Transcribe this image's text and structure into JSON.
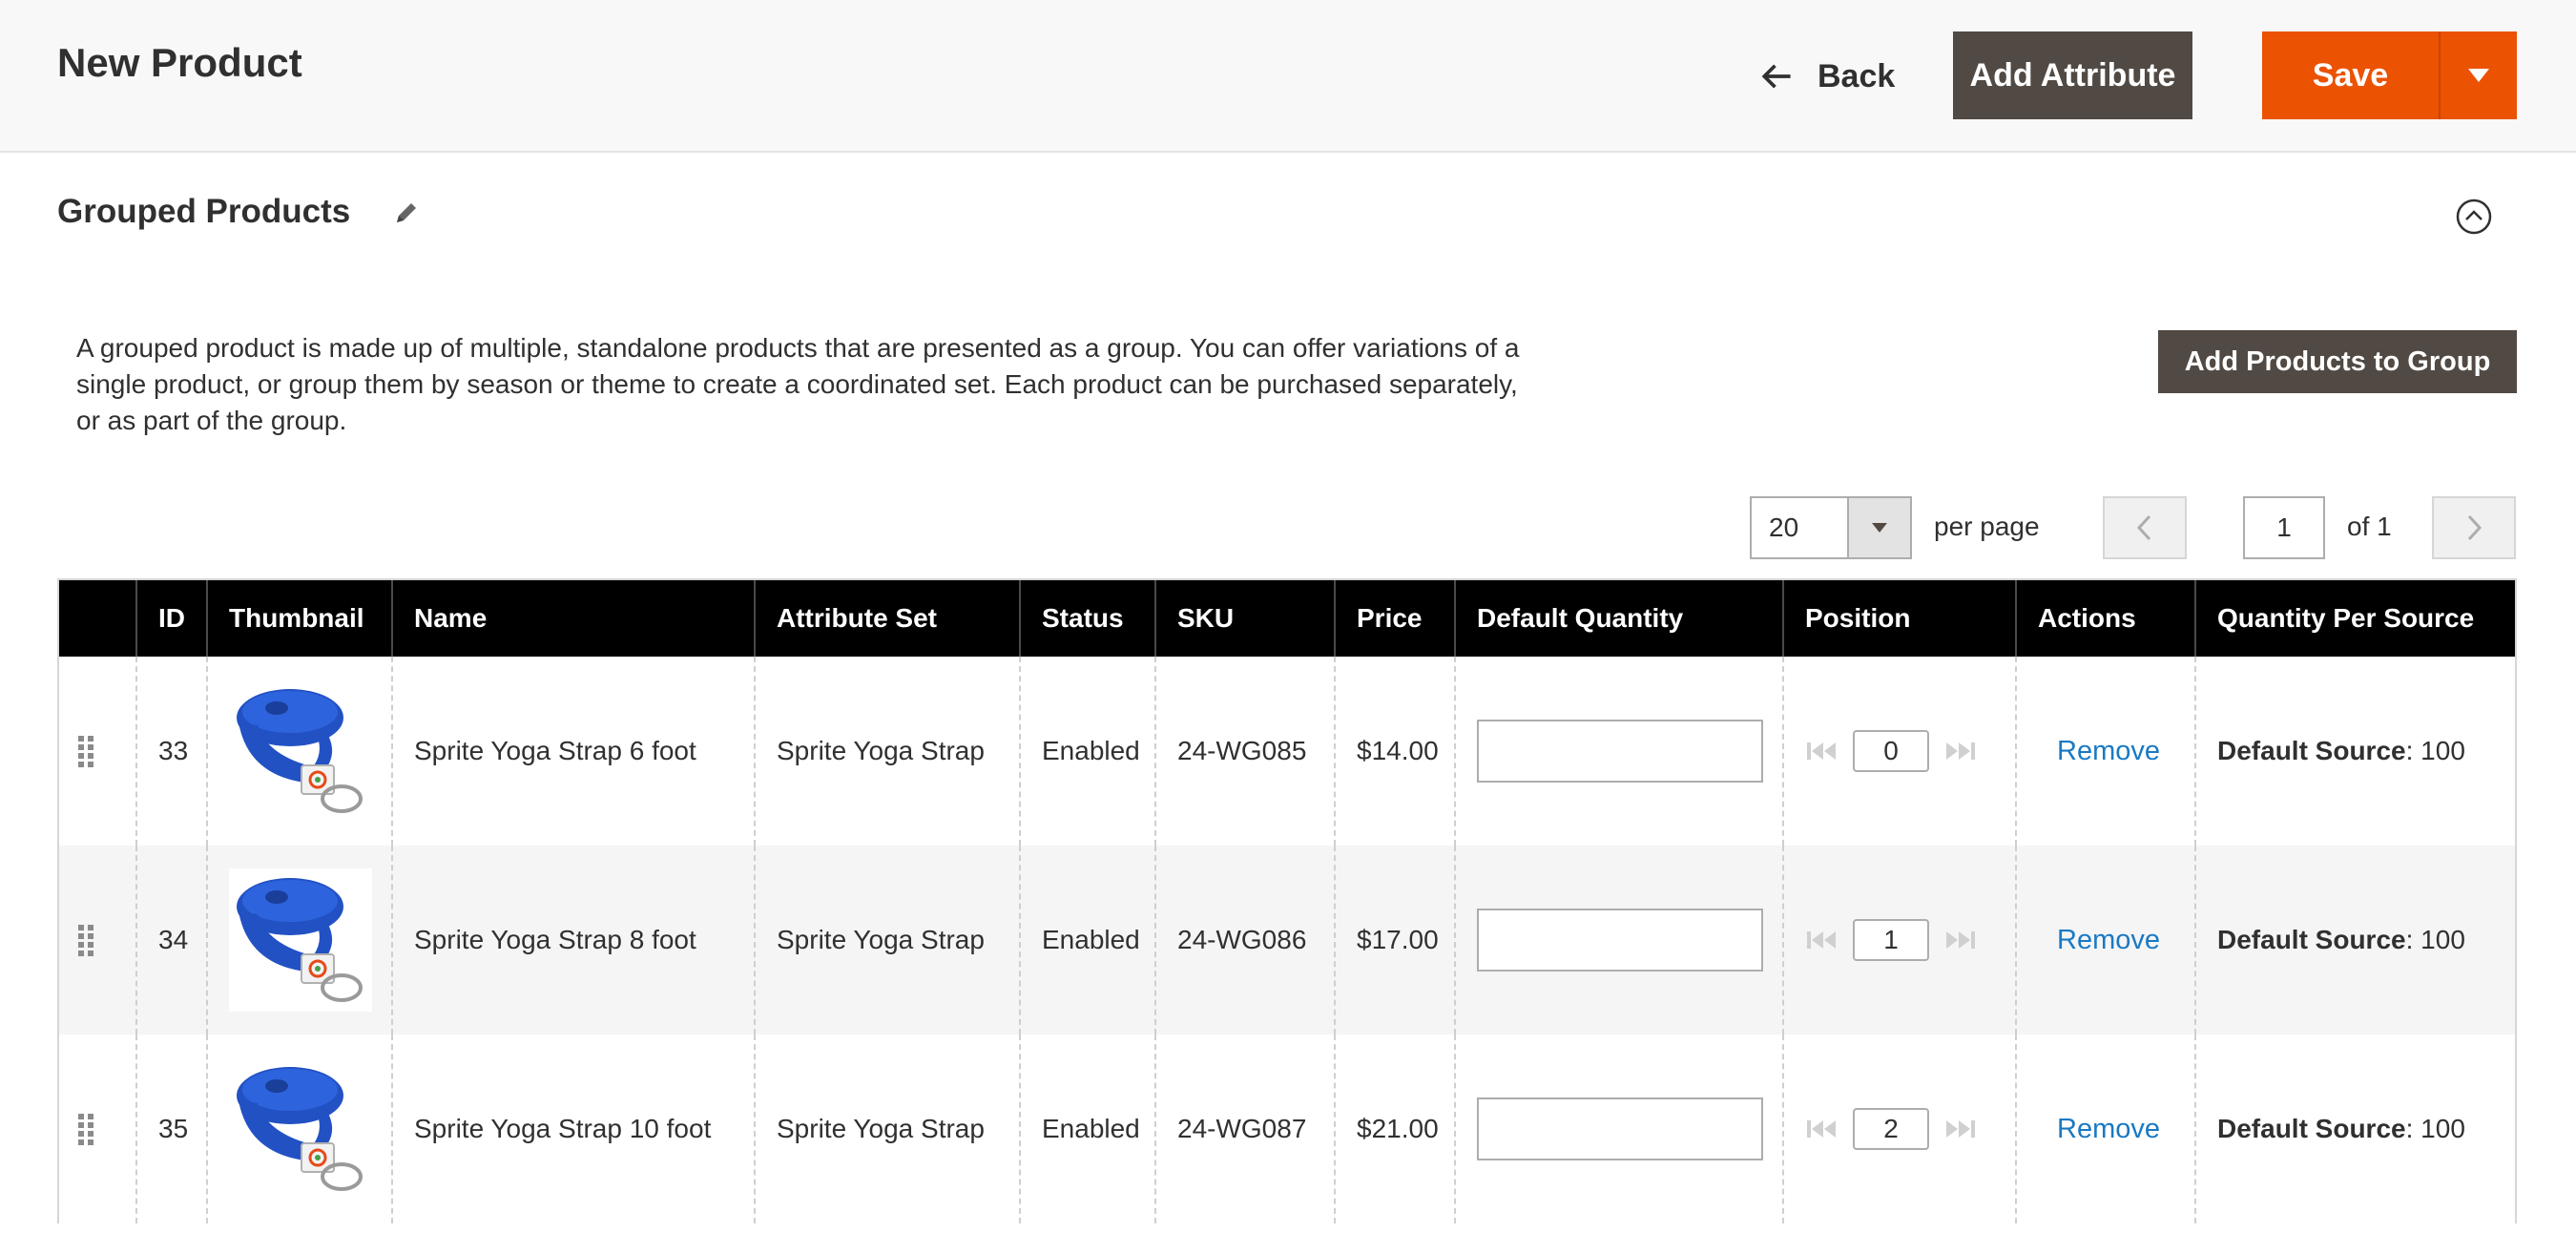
{
  "header": {
    "title": "New Product",
    "back_label": "Back",
    "add_attribute_label": "Add Attribute",
    "save_label": "Save"
  },
  "section": {
    "title": "Grouped Products",
    "description": "A grouped product is made up of multiple, standalone products that are presented as a group. You can offer variations of a single product, or group them by season or theme to create a coordinated set. Each product can be purchased separately, or as part of the group.",
    "add_products_label": "Add Products to Group"
  },
  "pager": {
    "per_page_value": "20",
    "per_page_label": "per page",
    "current_page": "1",
    "of_label": "of 1"
  },
  "table": {
    "columns": {
      "id": "ID",
      "thumbnail": "Thumbnail",
      "name": "Name",
      "attribute_set": "Attribute Set",
      "status": "Status",
      "sku": "SKU",
      "price": "Price",
      "default_quantity": "Default Quantity",
      "position": "Position",
      "actions": "Actions",
      "quantity_per_source": "Quantity Per Source"
    },
    "rows": [
      {
        "id": "33",
        "name": "Sprite Yoga Strap 6 foot",
        "attribute_set": "Sprite Yoga Strap",
        "status": "Enabled",
        "sku": "24-WG085",
        "price": "$14.00",
        "default_quantity": "",
        "position": "0",
        "action": "Remove",
        "qps_label": "Default Source",
        "qps_value": ": 100"
      },
      {
        "id": "34",
        "name": "Sprite Yoga Strap 8 foot",
        "attribute_set": "Sprite Yoga Strap",
        "status": "Enabled",
        "sku": "24-WG086",
        "price": "$17.00",
        "default_quantity": "",
        "position": "1",
        "action": "Remove",
        "qps_label": "Default Source",
        "qps_value": ": 100"
      },
      {
        "id": "35",
        "name": "Sprite Yoga Strap 10 foot",
        "attribute_set": "Sprite Yoga Strap",
        "status": "Enabled",
        "sku": "24-WG087",
        "price": "$21.00",
        "default_quantity": "",
        "position": "2",
        "action": "Remove",
        "qps_label": "Default Source",
        "qps_value": ": 100"
      }
    ]
  },
  "icons": {
    "back": "arrow-left-icon",
    "save_split": "caret-down-icon",
    "edit": "pencil-icon",
    "collapse": "chevron-up-circle-icon",
    "drag": "drag-handle-icon",
    "pager_prev": "chevron-left-icon",
    "pager_next": "chevron-right-icon",
    "position_first": "skip-to-first-icon",
    "position_last": "skip-to-last-icon"
  },
  "colors": {
    "primary_action": "#eb5202",
    "secondary_action": "#514943",
    "link": "#1979c3",
    "table_header": "#000000"
  }
}
